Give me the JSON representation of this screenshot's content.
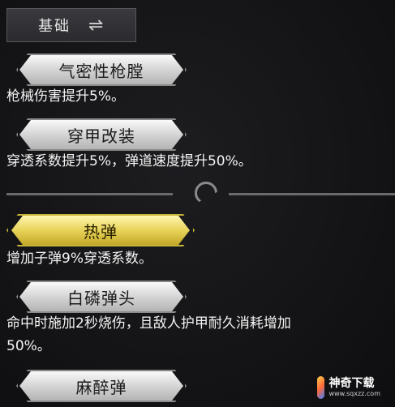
{
  "tab": {
    "label": "基础",
    "icon": "swap-arrows-icon"
  },
  "perks": [
    {
      "name": "气密性枪膛",
      "desc": "枪械伤害提升5%。"
    },
    {
      "name": "穿甲改装",
      "desc": "穿透系数提升5%，弹道速度提升50%。"
    },
    {
      "name": "热弹",
      "desc": "增加子弹9%穿透系数。",
      "selected": true
    },
    {
      "name": "白磷弹头",
      "desc_line1": "命中时施加2秒烧伤，且敌人护甲耐久消耗增加",
      "desc_line2": "50%。"
    },
    {
      "name": "麻醉弹"
    }
  ],
  "watermark": {
    "title": "神奇下载",
    "url": "www.sqxzz.com"
  },
  "colors": {
    "selected_accent": "#e8d35a",
    "normal_badge": "#d8d8d8"
  }
}
